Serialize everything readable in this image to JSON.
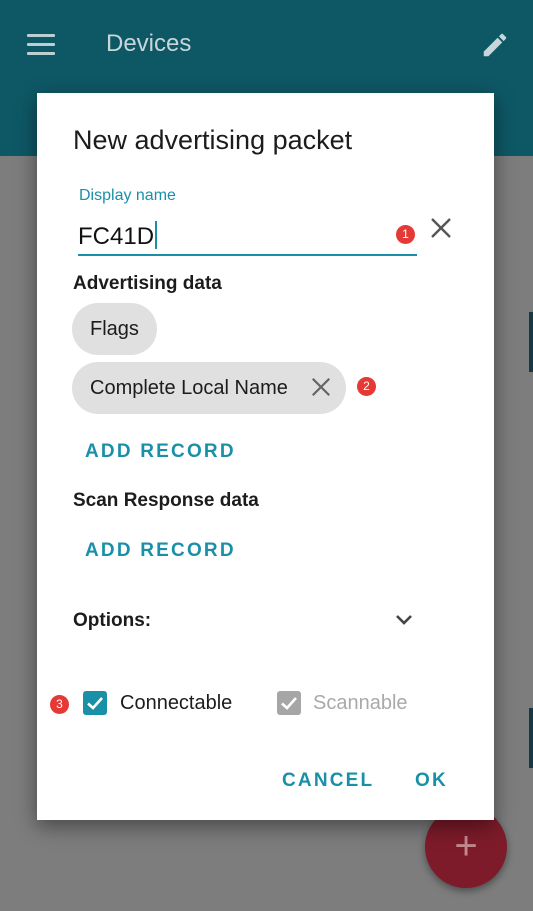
{
  "app": {
    "title": "Devices"
  },
  "dialog": {
    "title": "New advertising packet",
    "display_name": {
      "label": "Display name",
      "value": "FC41D"
    },
    "advertising_data": {
      "heading": "Advertising data",
      "chips": [
        {
          "label": "Flags",
          "removable": false
        },
        {
          "label": "Complete Local Name",
          "removable": true
        }
      ],
      "add_label": "ADD RECORD"
    },
    "scan_response": {
      "heading": "Scan Response data",
      "add_label": "ADD RECORD"
    },
    "options": {
      "label": "Options:"
    },
    "checkboxes": [
      {
        "label": "Connectable",
        "checked": true,
        "enabled": true
      },
      {
        "label": "Scannable",
        "checked": true,
        "enabled": false
      }
    ],
    "actions": {
      "cancel": "CANCEL",
      "ok": "OK"
    }
  },
  "badges": [
    "1",
    "2",
    "3"
  ],
  "colors": {
    "accent": "#1a90a8",
    "appbar": "#0e5866",
    "fab": "#7e1b2a",
    "badge": "#e53935",
    "chip": "#e0e0e0"
  },
  "icons": [
    "menu-icon",
    "edit-icon",
    "clear-icon",
    "close-icon",
    "chevron-down-icon",
    "checkbox-icon",
    "add-icon"
  ]
}
